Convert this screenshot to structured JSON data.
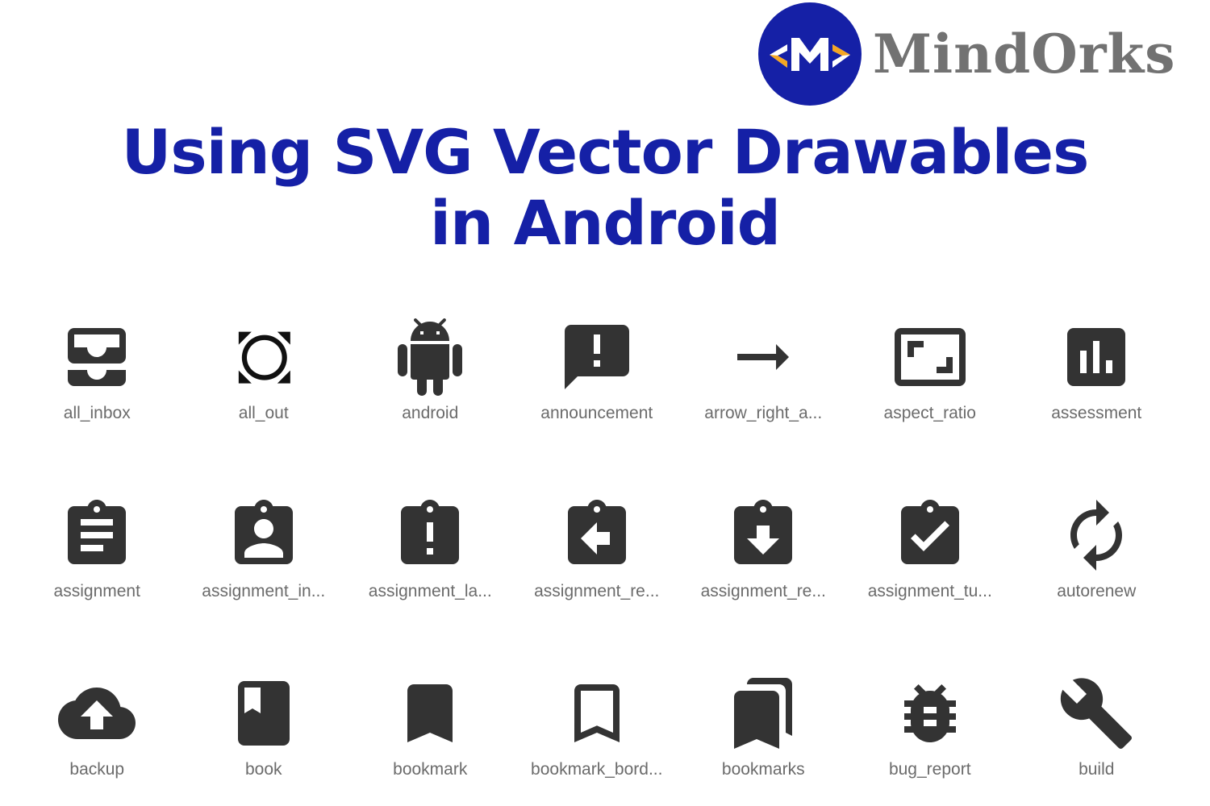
{
  "brand": {
    "name": "MindOrks",
    "logo_letter": "M",
    "logo_bg_color": "#1520a6",
    "logo_accent_color": "#f5a623",
    "name_color": "#727272"
  },
  "headline": {
    "line1": "Using SVG Vector Drawables",
    "line2": "in Android",
    "color": "#1520a6"
  },
  "icon_color": "#333333",
  "icons": [
    {
      "name": "all_inbox",
      "label": "all_inbox"
    },
    {
      "name": "all_out",
      "label": "all_out"
    },
    {
      "name": "android",
      "label": "android"
    },
    {
      "name": "announcement",
      "label": "announcement"
    },
    {
      "name": "arrow_right_alt",
      "label": "arrow_right_a..."
    },
    {
      "name": "aspect_ratio",
      "label": "aspect_ratio"
    },
    {
      "name": "assessment",
      "label": "assessment"
    },
    {
      "name": "assignment",
      "label": "assignment"
    },
    {
      "name": "assignment_ind",
      "label": "assignment_in..."
    },
    {
      "name": "assignment_late",
      "label": "assignment_la..."
    },
    {
      "name": "assignment_return",
      "label": "assignment_re..."
    },
    {
      "name": "assignment_returned",
      "label": "assignment_re..."
    },
    {
      "name": "assignment_turned_in",
      "label": "assignment_tu..."
    },
    {
      "name": "autorenew",
      "label": "autorenew"
    },
    {
      "name": "backup",
      "label": "backup"
    },
    {
      "name": "book",
      "label": "book"
    },
    {
      "name": "bookmark",
      "label": "bookmark"
    },
    {
      "name": "bookmark_border",
      "label": "bookmark_bord..."
    },
    {
      "name": "bookmarks",
      "label": "bookmarks"
    },
    {
      "name": "bug_report",
      "label": "bug_report"
    },
    {
      "name": "build",
      "label": "build"
    }
  ]
}
